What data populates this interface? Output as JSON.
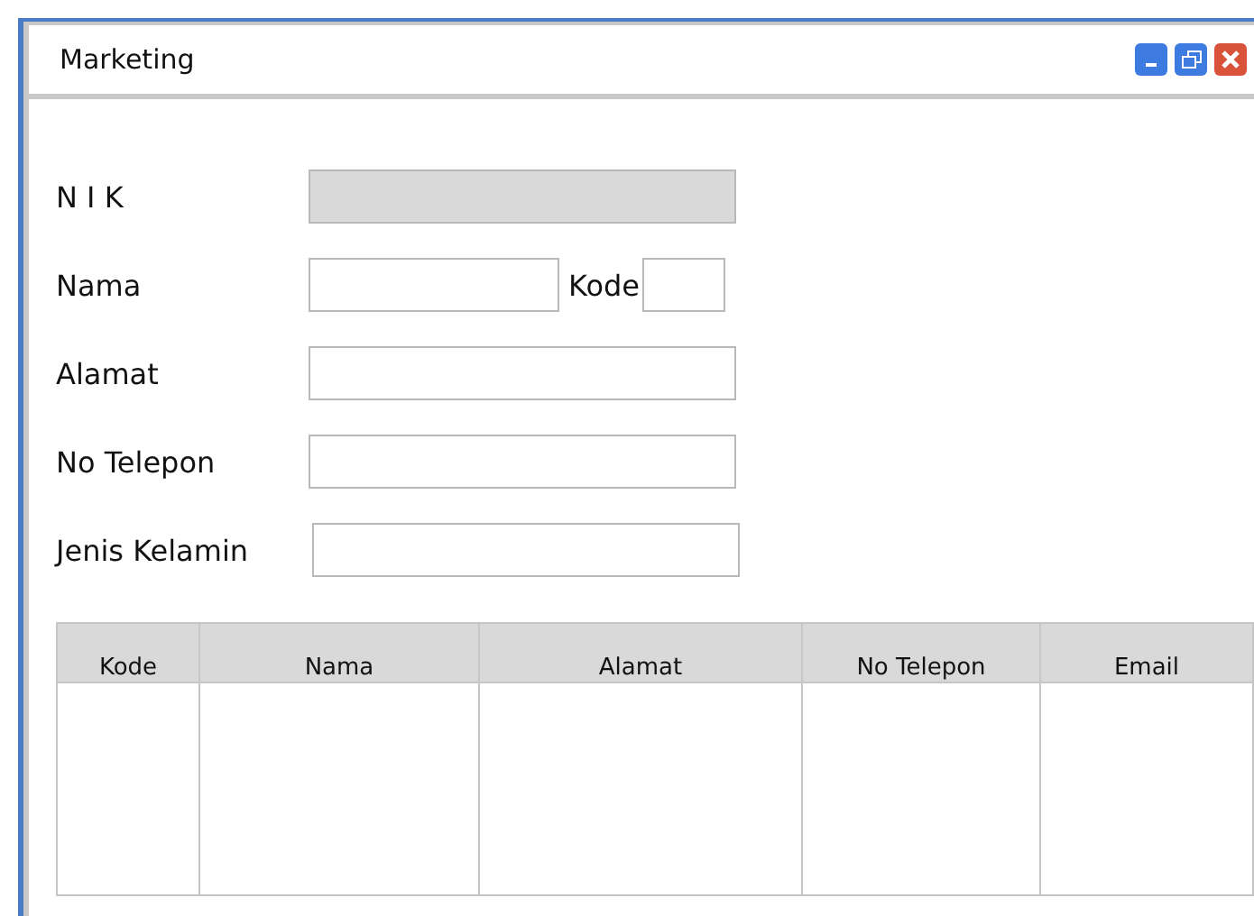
{
  "window": {
    "title": "Marketing"
  },
  "fields": [
    {
      "label": "N I K",
      "kind": "text",
      "disabled": true
    },
    {
      "label": "Nama",
      "kind": "pair",
      "disabled": false,
      "second_label": "Kode"
    },
    {
      "label": "Alamat",
      "kind": "text",
      "disabled": false
    },
    {
      "label": "No Telepon",
      "kind": "text",
      "disabled": false
    },
    {
      "label": "Jenis Kelamin",
      "kind": "text",
      "disabled": false
    }
  ],
  "table": {
    "columns": [
      "Kode",
      "Nama",
      "Alamat",
      "No Telepon",
      "Email"
    ]
  }
}
